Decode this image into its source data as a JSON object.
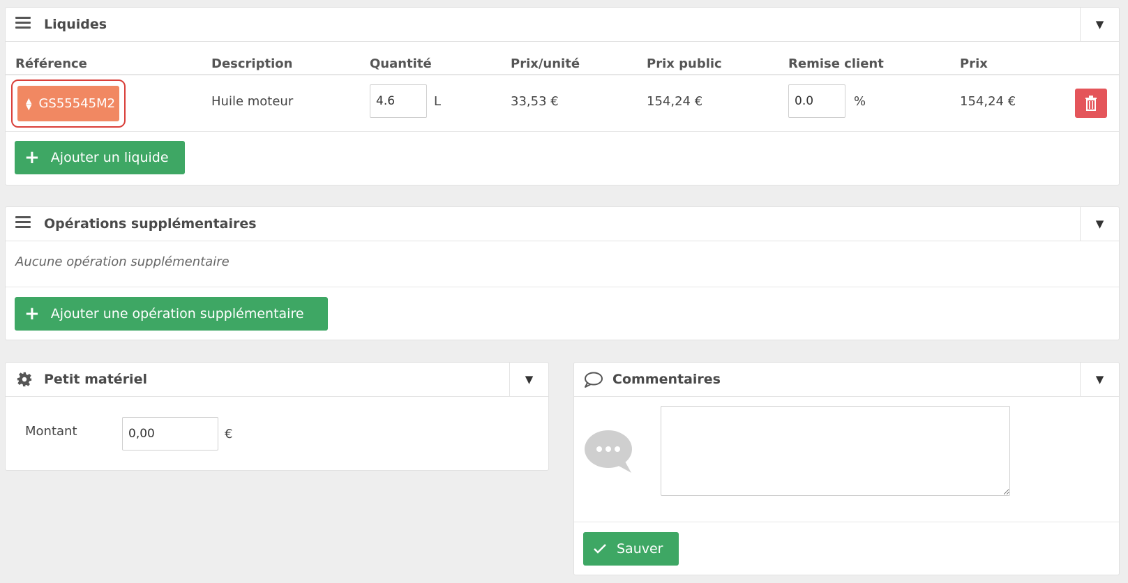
{
  "liquides": {
    "title": "Liquides",
    "columns": [
      "Référence",
      "Description",
      "Quantité",
      "Prix/unité",
      "Prix public",
      "Remise client",
      "Prix"
    ],
    "row": {
      "reference": "GS55545M2",
      "description": "Huile moteur",
      "quantite": "4.6",
      "unit": "L",
      "prix_unite": "33,53 €",
      "prix_public": "154,24 €",
      "remise": "0.0",
      "remise_unit": "%",
      "prix": "154,24 €"
    },
    "add_label": "Ajouter un liquide"
  },
  "operations": {
    "title": "Opérations supplémentaires",
    "empty_text": "Aucune opération supplémentaire",
    "add_label": "Ajouter une opération supplémentaire"
  },
  "petit_materiel": {
    "title": "Petit matériel",
    "montant_label": "Montant",
    "montant_value": "0,00",
    "currency": "€"
  },
  "commentaires": {
    "title": "Commentaires",
    "text": "",
    "save_label": "Sauver"
  },
  "icons": {
    "menu": "menu-icon",
    "gear": "gear-icon",
    "comment": "comment-icon",
    "delete": "trash-icon",
    "plus": "plus-icon",
    "check": "check-icon"
  },
  "colors": {
    "green": "#3ea764",
    "orange": "#f18862",
    "red": "#e4555a",
    "highlight": "#d9403a"
  }
}
